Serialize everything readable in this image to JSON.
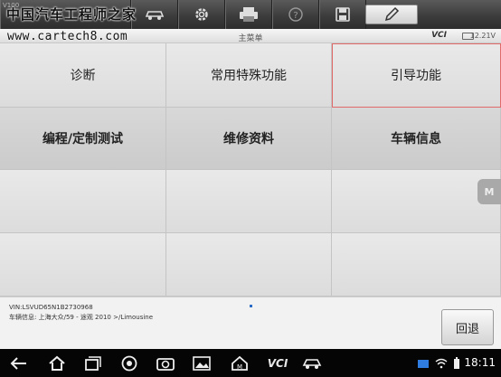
{
  "toolbar": {
    "logo_text": "中国汽车工程师之家",
    "version_label": "V100",
    "buttons": [
      "car-icon",
      "gear-icon",
      "printer-icon",
      "help-icon",
      "save-icon",
      "pen-icon"
    ]
  },
  "titlebar": {
    "watermark_url": "www.cartech8.com",
    "title": "主菜单",
    "vci_label": "VCI",
    "voltage": "12.21V"
  },
  "menu": {
    "items": [
      {
        "label": "诊断"
      },
      {
        "label": "常用特殊功能"
      },
      {
        "label": "引导功能"
      },
      {
        "label": "编程/定制测试"
      },
      {
        "label": "维修资料"
      },
      {
        "label": "车辆信息"
      }
    ]
  },
  "side_button": {
    "label": "M"
  },
  "info": {
    "vin": "VIN:LSVUD65N1B2730968",
    "vehicle": "车辆信息: 上海大众/59 - 途观 2010 >/Limousine"
  },
  "back_button": {
    "label": "回退"
  },
  "navbar": {
    "vci_label": "VCI",
    "time": "18:11"
  }
}
